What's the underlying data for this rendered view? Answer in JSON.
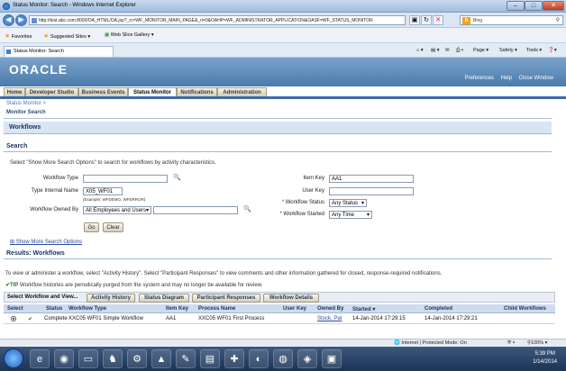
{
  "window": {
    "title": "Status Monitor: Search - Windows Internet Explorer"
  },
  "browser": {
    "url": "http://test.abc.com:8000/OA_HTML/OA.jsp?_rc=WF_MONITOR_MAIN_PAGE&_ri=0&OAHP=WF_ADMINISTRATOR_APPLICATION&OASF=WF_STATUS_MONITOR",
    "search_placeholder": "Bing",
    "favorites_label": "Favorites",
    "suggested_sites": "Suggested Sites ▾",
    "web_slice_gallery": "Web Slice Gallery ▾",
    "tab_title": "Status Monitor: Search",
    "cmd_page": "Page ▾",
    "cmd_safety": "Safety ▾",
    "cmd_tools": "Tools ▾"
  },
  "header": {
    "logo": "ORACLE",
    "links": [
      "Preferences",
      "Help",
      "Close Window"
    ]
  },
  "tabs": [
    {
      "label": "Home"
    },
    {
      "label": "Developer Studio"
    },
    {
      "label": "Business Events"
    },
    {
      "label": "Status Monitor",
      "active": true
    },
    {
      "label": "Notifications"
    },
    {
      "label": "Administration"
    }
  ],
  "breadcrumb": "Status Monitor  >",
  "page_subtitle": "Monitor Search",
  "section_title": "Workflows",
  "search": {
    "title": "Search",
    "instructions": "Select \"Show More Search Options\" to search for workflows by activity characteristics.",
    "workflow_type_label": "Workflow Type",
    "workflow_type_value": "",
    "type_internal_name_label": "Type Internal Name",
    "type_internal_name_value": "X05_WF01",
    "type_internal_name_hint": "(Example: WFDEMO, WFERROR)",
    "owned_by_label": "Workflow Owned By",
    "owned_by_select": "All Employees and Users",
    "owned_by_value": "",
    "item_key_label": "Item Key",
    "item_key_value": "AA1",
    "user_key_label": "User Key",
    "user_key_value": "",
    "status_label": "Workflow Status",
    "status_value": "Any Status",
    "started_label": "Workflow Started",
    "started_value": "Any Time",
    "go_label": "Go",
    "clear_label": "Clear",
    "more_options": "Show More Search Options"
  },
  "results": {
    "title": "Results: Workflows",
    "instructions": "To view or administer a workflow, select \"Activity History\". Select \"Participant Responses\" to view comments and other information gathered for closed, response-required notifications.",
    "tip_label": "TIP",
    "tip_text": "Workflow histories are periodically purged from the system and may no longer be available for review.",
    "action_label": "Select Workflow and View...",
    "actions": [
      "Activity History",
      "Status Diagram",
      "Participant Responses",
      "Workflow Details"
    ],
    "columns": [
      "Select",
      "Status",
      "Workflow Type",
      "Item Key",
      "Process Name",
      "User Key",
      "Owned By",
      "Started",
      "Completed",
      "Child Workflows"
    ],
    "rows": [
      {
        "status": "Complete",
        "workflow_type": "XXC05 WF01 Simple Workflow",
        "item_key": "AA1",
        "process_name": "XXC05 WF01 First Process",
        "user_key": "",
        "owned_by": "Stock, Pat",
        "started": "14-Jan-2014 17:29:15",
        "completed": "14-Jan-2014 17:29:21",
        "child_workflows": ""
      }
    ]
  },
  "statusbar": {
    "zone": "Internet | Protected Mode: On",
    "zoom": "100%"
  },
  "taskbar": {
    "time": "5:39 PM",
    "date": "1/14/2014"
  },
  "colors": {
    "oracle_band": "#4b7bab",
    "tab_line": "#3e6aa8",
    "section_bg": "#d9e5f3",
    "link": "#2a4a9c"
  }
}
